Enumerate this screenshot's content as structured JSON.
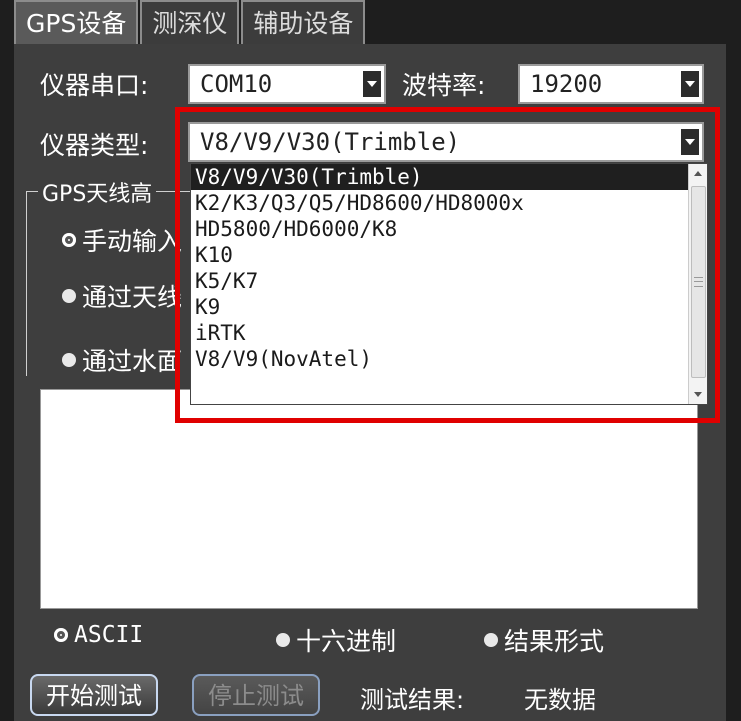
{
  "tabs": [
    {
      "label": "GPS设备"
    },
    {
      "label": "测深仪"
    },
    {
      "label": "辅助设备"
    }
  ],
  "form": {
    "serial_label": "仪器串口:",
    "serial_value": "COM10",
    "baud_label": "波特率:",
    "baud_value": "19200",
    "type_label": "仪器类型:",
    "type_value": "V8/V9/V30(Trimble)"
  },
  "antenna_group": {
    "title": "GPS天线高",
    "options": [
      "手动输入",
      "通过天线",
      "通过水面"
    ]
  },
  "dropdown": {
    "items": [
      "V8/V9/V30(Trimble)",
      "K2/K3/Q3/Q5/HD8600/HD8000x",
      "HD5800/HD6000/K8",
      "K10",
      "K5/K7",
      "K9",
      "iRTK",
      "V8/V9(NovAtel)"
    ],
    "selected_index": 0
  },
  "format_options": {
    "ascii": "ASCII",
    "hex": "十六进制",
    "result": "结果形式",
    "selected": "ASCII"
  },
  "actions": {
    "start_label": "开始测试",
    "stop_label": "停止测试",
    "result_label": "测试结果:",
    "result_value": "无数据"
  },
  "colors": {
    "highlight_box": "#e00000",
    "background": "#3e3e3e"
  }
}
